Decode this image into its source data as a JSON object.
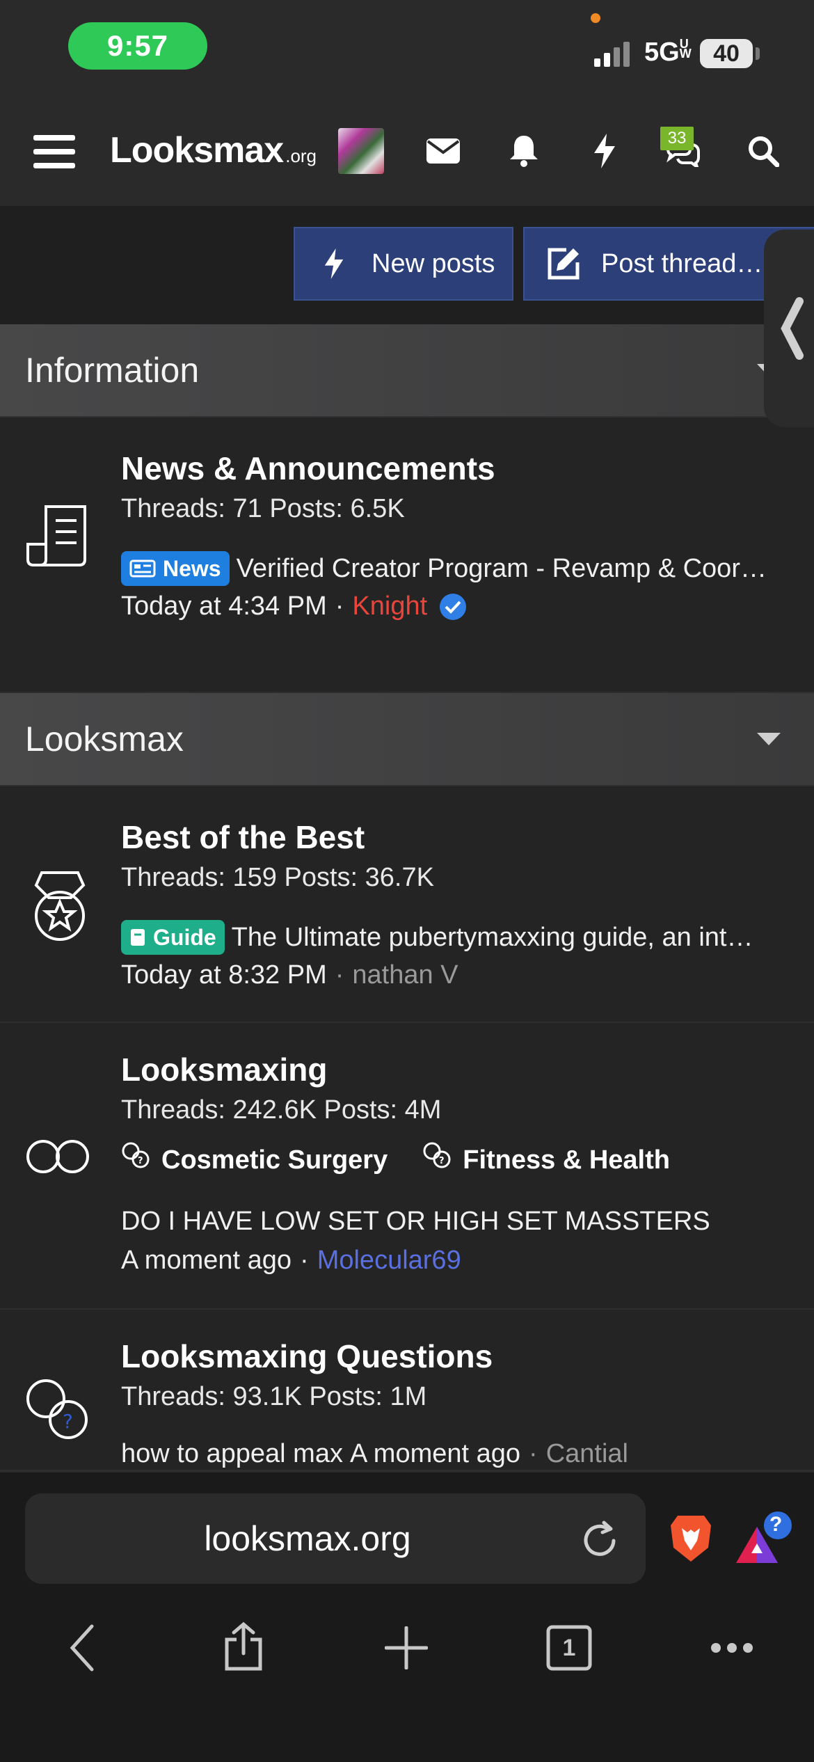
{
  "status_bar": {
    "time": "9:57",
    "network": "5G",
    "network_sub": "UW",
    "battery": "40"
  },
  "header": {
    "logo_main": "Looksmax",
    "logo_sub": ".org",
    "conversations_badge": "33"
  },
  "actions": {
    "new_posts_label": "New posts",
    "post_thread_label": "Post thread…"
  },
  "categories": [
    {
      "title": "Information",
      "forums": [
        {
          "title": "News & Announcements",
          "stats": "Threads: 71 Posts: 6.5K",
          "prefix": "News",
          "prefix_color": "#1e7fe0",
          "latest_title": "Verified Creator Program - Revamp & Coor…",
          "latest_time": "Today at 4:34 PM",
          "latest_user": "Knight",
          "latest_user_color": "#e8453c"
        }
      ]
    },
    {
      "title": "Looksmax",
      "forums": [
        {
          "title": "Best of the Best",
          "stats": "Threads: 159 Posts: 36.7K",
          "prefix": "Guide",
          "prefix_color": "#1fae8a",
          "latest_title": "The Ultimate pubertymaxxing guide, an int…",
          "latest_time": "Today at 8:32 PM",
          "latest_user": "nathan V",
          "latest_user_color": "#9a9a9a"
        },
        {
          "title": "Looksmaxing",
          "stats": "Threads: 242.6K Posts: 4M",
          "subforums": [
            "Cosmetic Surgery",
            "Fitness & Health"
          ],
          "latest_title": "DO I HAVE LOW SET OR HIGH SET MASSTERS",
          "latest_time": "A moment ago",
          "latest_user": "Molecular69",
          "latest_user_color": "#5a6fe0"
        },
        {
          "title": "Looksmaxing Questions",
          "stats": "Threads: 93.1K Posts: 1M",
          "latest_title": "how to appeal max",
          "latest_time": "A moment ago",
          "latest_user": "Cantial",
          "latest_user_color": "#9a9a9a"
        }
      ]
    }
  ],
  "browser": {
    "url": "looksmax.org",
    "tab_count": "1",
    "rewards_badge": "?"
  },
  "icons": {
    "menu": "hamburger-icon",
    "mail": "mail-icon",
    "alerts": "bell-icon",
    "whats_new": "bolt-icon",
    "conversations": "chat-icon",
    "search": "search-icon"
  }
}
